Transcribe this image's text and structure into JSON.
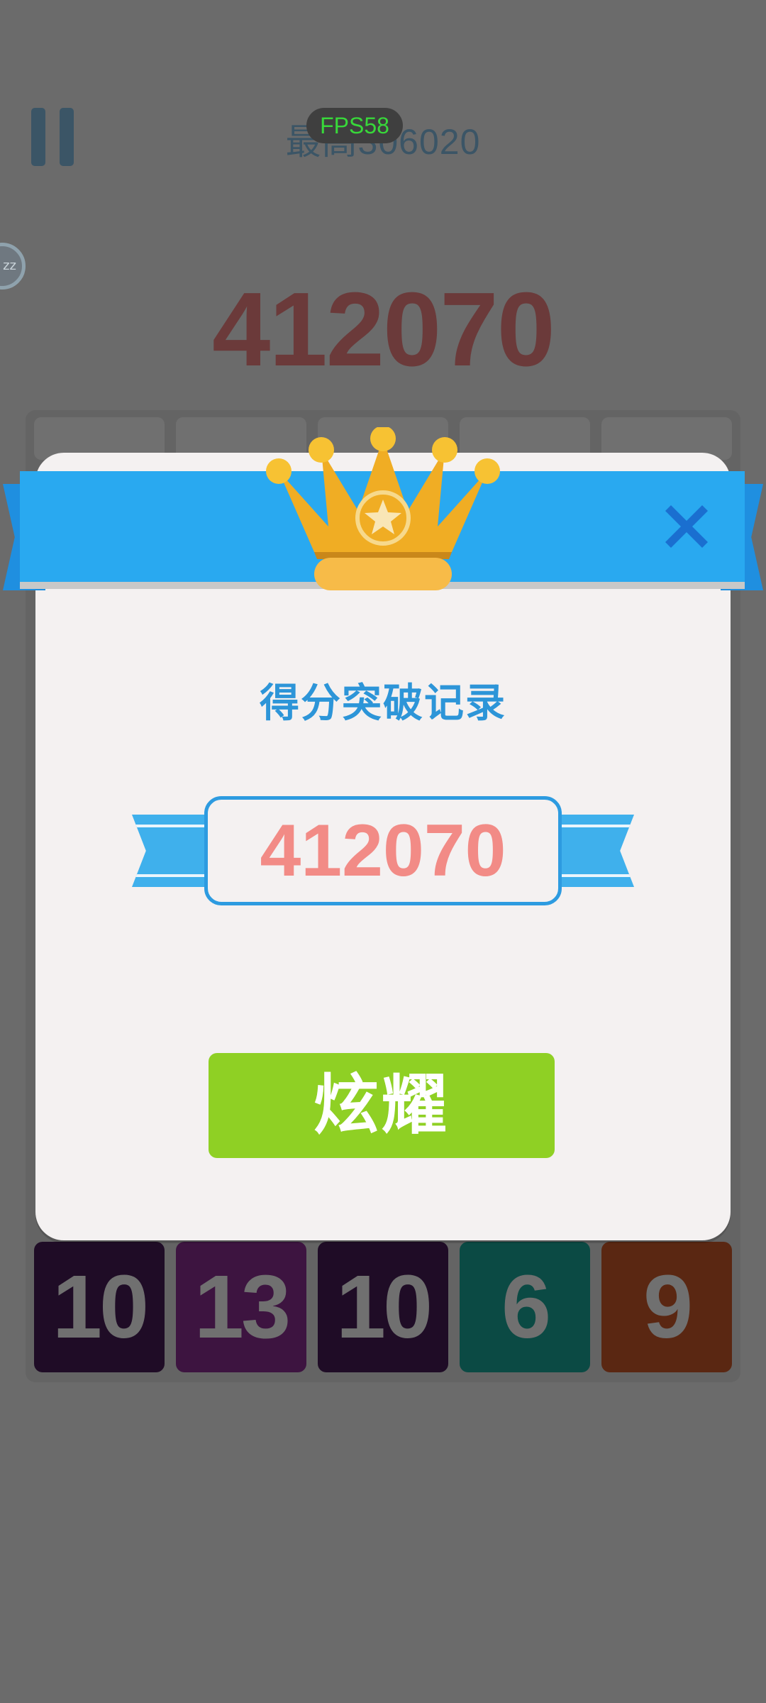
{
  "hud": {
    "best_score_label": "最高306020",
    "fps_label": "FPS58",
    "current_score": "412070",
    "sleep_label": "zz"
  },
  "tiles": [
    {
      "value": "10",
      "color": "#1f0c26"
    },
    {
      "value": "13",
      "color": "#3d1440"
    },
    {
      "value": "10",
      "color": "#1f0c26"
    },
    {
      "value": "6",
      "color": "#0b4a44"
    },
    {
      "value": "9",
      "color": "#5a2712"
    }
  ],
  "dialog": {
    "title": "得分突破记录",
    "score": "412070",
    "share_button": "炫耀",
    "close_icon": "close-x-icon",
    "crown_icon": "crown-icon"
  },
  "colors": {
    "ribbon": "#29a9f0",
    "title": "#2d95d8",
    "score": "#f28b86",
    "button": "#8fd024",
    "crown": "#f0ad24"
  }
}
